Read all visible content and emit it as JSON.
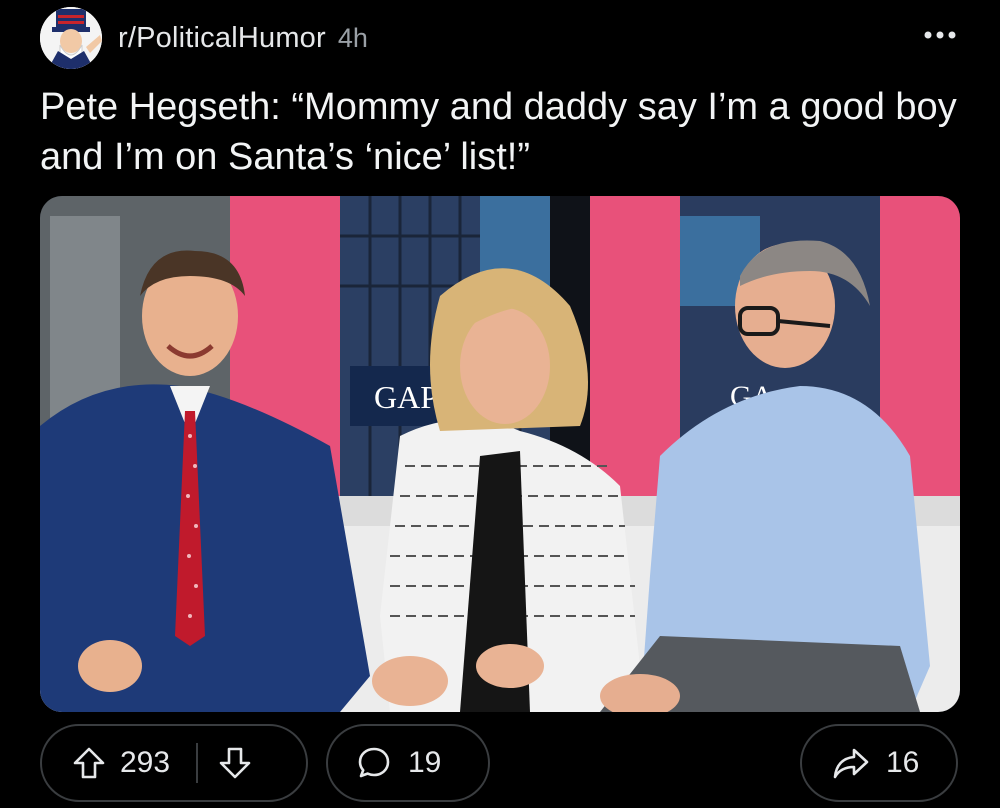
{
  "post": {
    "subreddit": "r/PoliticalHumor",
    "age": "4h",
    "title": "Pete Hegseth: “Mommy and daddy say I’m a good boy and I’m on Santa’s ‘nice’ list!”",
    "media": {
      "sign_text_1": "GAP",
      "sign_text_2": "GA"
    }
  },
  "actions": {
    "upvotes": "293",
    "comments": "19",
    "shares": "16"
  },
  "icons": {
    "avatar": "uncle-sam-avatar",
    "more": "more-options-icon",
    "upvote": "upvote-arrow-icon",
    "downvote": "downvote-arrow-icon",
    "comment": "comment-bubble-icon",
    "share": "share-arrow-icon"
  },
  "colors": {
    "background": "#000000",
    "pill_border": "#3a3d40",
    "accent_pink": "#e8517a"
  }
}
